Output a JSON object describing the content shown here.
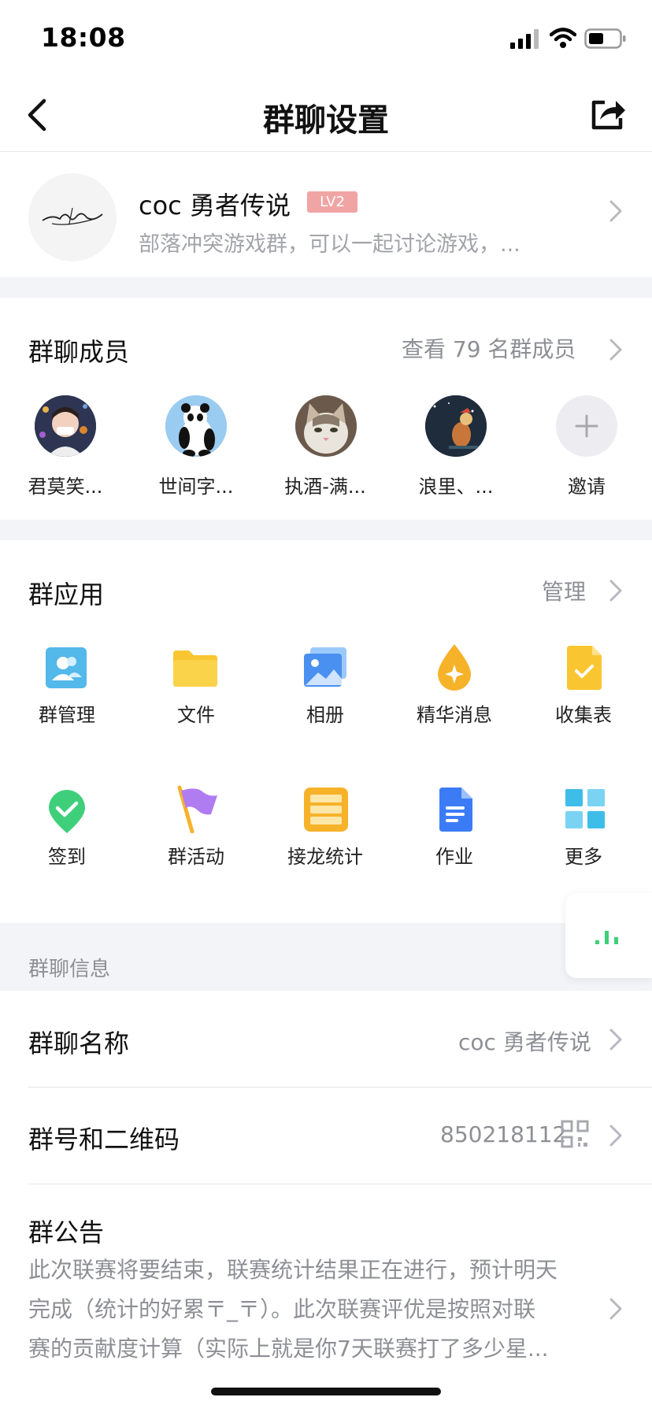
{
  "status_bar": {
    "time": "18:08"
  },
  "nav": {
    "title": "群聊设置"
  },
  "group": {
    "name": "coc 勇者传说",
    "level": "LV2",
    "description": "部落冲突游戏群，可以一起讨论游戏，..."
  },
  "members": {
    "title": "群聊成员",
    "view_all": "查看 79 名群成员",
    "list": [
      {
        "name": "君莫笑..."
      },
      {
        "name": "世间字..."
      },
      {
        "name": "执酒-满..."
      },
      {
        "name": "浪里、..."
      }
    ],
    "invite_label": "邀请"
  },
  "apps": {
    "title": "群应用",
    "manage_label": "管理",
    "row1": [
      {
        "label": "群管理",
        "icon": "group-manage-icon"
      },
      {
        "label": "文件",
        "icon": "folder-icon"
      },
      {
        "label": "相册",
        "icon": "photo-album-icon"
      },
      {
        "label": "精华消息",
        "icon": "essence-drop-icon"
      },
      {
        "label": "收集表",
        "icon": "collect-form-icon"
      }
    ],
    "row2": [
      {
        "label": "签到",
        "icon": "checkin-icon"
      },
      {
        "label": "群活动",
        "icon": "flag-icon"
      },
      {
        "label": "接龙统计",
        "icon": "list-stats-icon"
      },
      {
        "label": "作业",
        "icon": "homework-doc-icon"
      },
      {
        "label": "更多",
        "icon": "grid-more-icon"
      }
    ]
  },
  "info": {
    "section_label": "群聊信息",
    "name_row": {
      "title": "群聊名称",
      "value": "coc 勇者传说"
    },
    "number_row": {
      "title": "群号和二维码",
      "value": "850218112"
    },
    "notice": {
      "title": "群公告",
      "lines": [
        "此次联赛将要结束，联赛统计结果正在进行，预计明天",
        "完成（统计的好累〒_〒）。此次联赛评优是按照对联",
        "赛的贡献度计算（实际上就是你7天联赛打了多少星..."
      ]
    }
  },
  "colors": {
    "accent": "#3b7cf6",
    "badge": "#f0a4a4",
    "gap": "#f3f4f8",
    "secondary_text": "#8e8f95"
  }
}
